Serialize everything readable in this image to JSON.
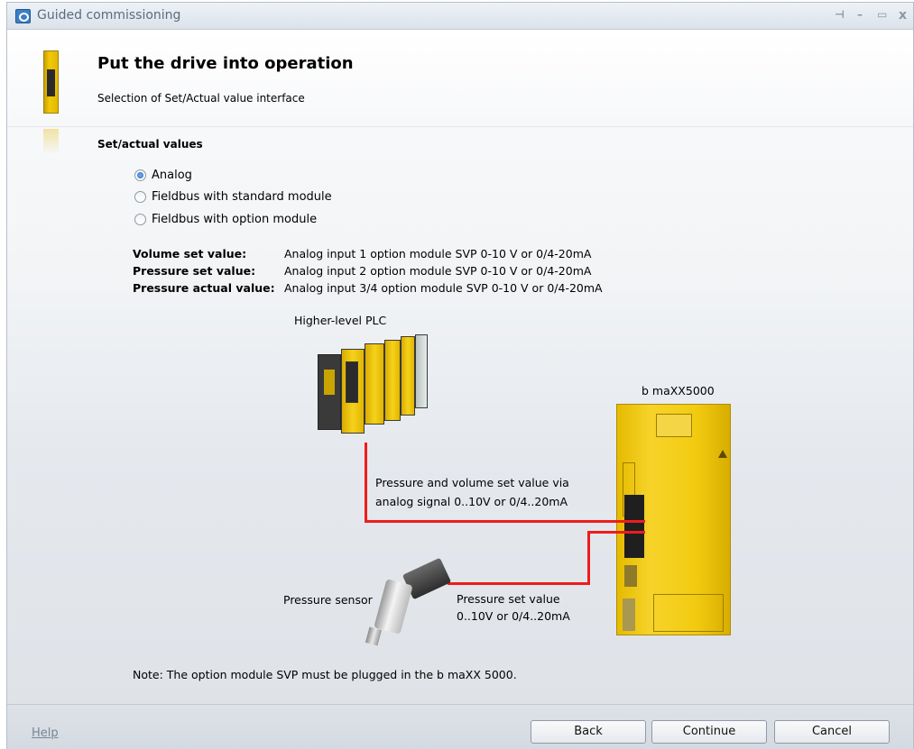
{
  "window": {
    "title": "Guided commissioning",
    "controls": [
      "⊣",
      "–",
      "▭",
      "x"
    ]
  },
  "header": {
    "title": "Put the drive into operation",
    "subtitle": "Selection of Set/Actual value interface"
  },
  "section": {
    "title": "Set/actual values",
    "options": [
      {
        "label": "Analog",
        "selected": true
      },
      {
        "label": "Fieldbus with standard module",
        "selected": false
      },
      {
        "label": "Fieldbus with option module",
        "selected": false
      }
    ]
  },
  "assignments": [
    {
      "label": "Volume set value:",
      "value": "Analog input 1 option module SVP 0-10 V or 0/4-20mA"
    },
    {
      "label": "Pressure set value:",
      "value": "Analog input 2 option module SVP 0-10 V or 0/4-20mA"
    },
    {
      "label": "Pressure actual value:",
      "value": "Analog input 3/4 option module SVP 0-10 V or 0/4-20mA"
    }
  ],
  "diagram": {
    "plc_label": "Higher-level PLC",
    "drive_label": "b maXX5000",
    "sensor_label": "Pressure sensor",
    "signal_line1": "Pressure and volume set value via",
    "signal_line2": "analog signal 0..10V or 0/4..20mA",
    "sensor_signal_line1": "Pressure set value",
    "sensor_signal_line2": "0..10V or 0/4..20mA",
    "wire_color": "#ef1c1c"
  },
  "note": "Note: The option module SVP must be plugged in the b maXX 5000.",
  "footer": {
    "help": "Help",
    "back": "Back",
    "continue": "Continue",
    "cancel": "Cancel"
  }
}
